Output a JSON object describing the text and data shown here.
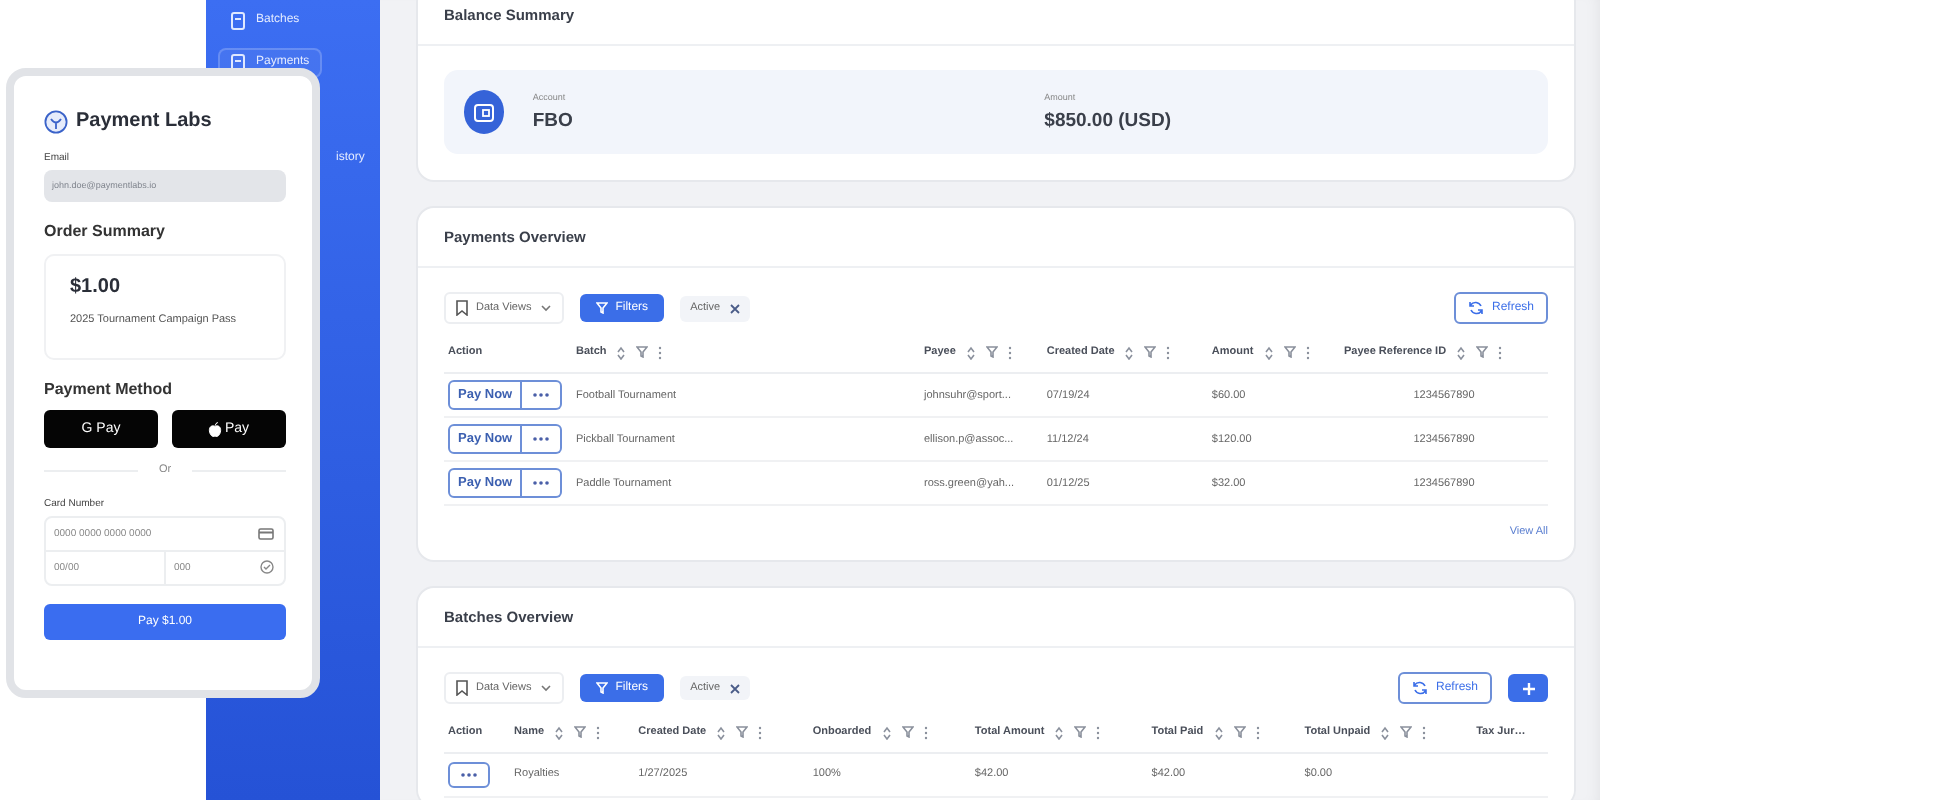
{
  "sidebar": {
    "items": [
      {
        "label": "Batches",
        "selected": false,
        "partial": false
      },
      {
        "label": "Payments",
        "selected": true,
        "partial": false
      },
      {
        "label": "istory",
        "selected": false,
        "partial": true
      }
    ]
  },
  "balance_summary": {
    "title": "Balance Summary",
    "account_label": "Account",
    "account": "FBO",
    "amount_label": "Amount",
    "amount": "$850.00 (USD)"
  },
  "payments_overview": {
    "title": "Payments Overview",
    "data_views": "Data Views",
    "filters": "Filters",
    "chip": "Active",
    "refresh": "Refresh",
    "action_column": "Action",
    "columns": [
      "Batch",
      "Payee",
      "Created Date",
      "Amount",
      "Payee Reference ID"
    ],
    "rows": [
      {
        "pay": "Pay Now",
        "cells": [
          "Football Tournament",
          "johnsuhr@sport...",
          "07/19/24",
          "$60.00",
          "1234567890"
        ]
      },
      {
        "pay": "Pay Now",
        "cells": [
          "Pickball Tournament",
          "ellison.p@assoc...",
          "11/12/24",
          "$120.00",
          "1234567890"
        ]
      },
      {
        "pay": "Pay Now",
        "cells": [
          "Paddle Tournament",
          "ross.green@yah...",
          "01/12/25",
          "$32.00",
          "1234567890"
        ]
      }
    ],
    "view_all": "View All"
  },
  "batches_overview": {
    "title": "Batches Overview",
    "data_views": "Data Views",
    "filters": "Filters",
    "chip": "Active",
    "refresh": "Refresh",
    "add_button": true,
    "action_column": "Action",
    "columns": [
      "Name",
      "Created Date",
      "Onboarded",
      "Total Amount",
      "Total Paid",
      "Total Unpaid",
      "Tax Jur…"
    ],
    "rows": [
      {
        "cells": [
          "Royalties",
          "1/27/2025",
          "100%",
          "$42.00",
          "$42.00",
          "$0.00"
        ]
      }
    ]
  },
  "checkout": {
    "brand": "Payment Labs",
    "email_label": "Email",
    "email": "john.doe@paymentlabs.io",
    "order_title": "Order Summary",
    "price": "$1.00",
    "item": "2025 Tournament Campaign Pass",
    "method_title": "Payment Method",
    "google_pay": "G Pay",
    "apple_pay": "Pay",
    "divider": "Or",
    "card_label": "Card Number",
    "card_placeholder": "0000 0000 0000 0000",
    "expiry_placeholder": "00/00",
    "cvc_placeholder": "000",
    "pay_button": "Pay $1.00"
  }
}
